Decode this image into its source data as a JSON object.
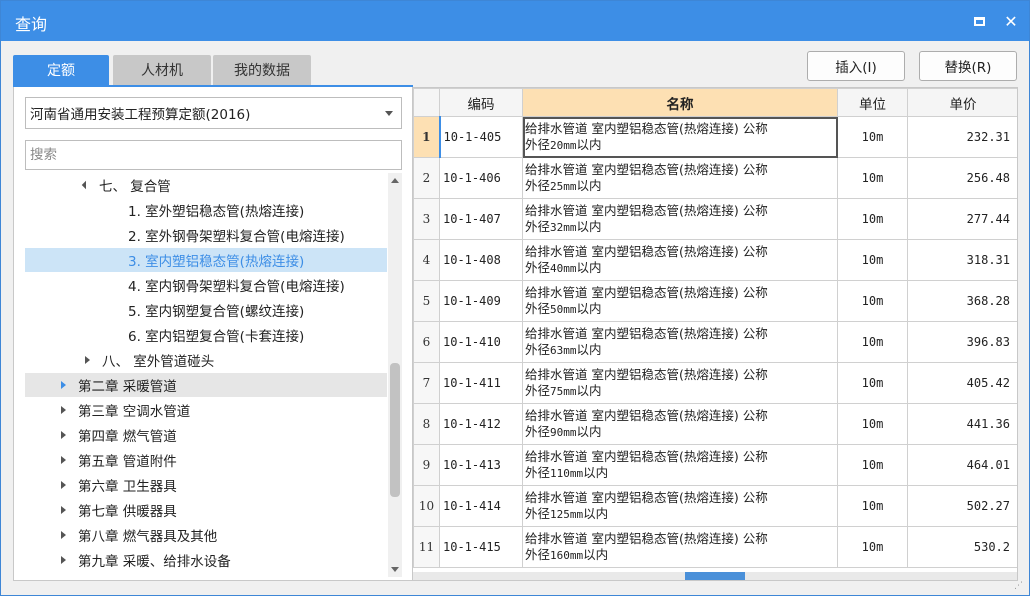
{
  "window": {
    "title": "查询"
  },
  "tabs": [
    "定额",
    "人材机",
    "我的数据"
  ],
  "toolbar": {
    "insert_label": "插入(I)",
    "replace_label": "替换(R)"
  },
  "dropdown": {
    "selected": "河南省通用安装工程预算定额(2016)"
  },
  "search": {
    "placeholder": "搜索"
  },
  "tree": {
    "group_7": "七、 复合管",
    "items_7": [
      "1. 室外塑铝稳态管(热熔连接)",
      "2. 室外钢骨架塑料复合管(电熔连接)",
      "3. 室内塑铝稳态管(热熔连接)",
      "4. 室内钢骨架塑料复合管(电熔连接)",
      "5. 室内钢塑复合管(螺纹连接)",
      "6. 室内铝塑复合管(卡套连接)"
    ],
    "group_8": "八、 室外管道碰头",
    "chapters": [
      "第二章 采暖管道",
      "第三章 空调水管道",
      "第四章 燃气管道",
      "第五章 管道附件",
      "第六章 卫生器具",
      "第七章 供暖器具",
      "第八章 燃气器具及其他",
      "第九章 采暖、给排水设备"
    ]
  },
  "table": {
    "headers": [
      "编码",
      "名称",
      "单位",
      "单价"
    ],
    "rows": [
      {
        "n": "1",
        "code": "10-1-405",
        "name1": "给排水管道 室内塑铝稳态管(热熔连接) 公称",
        "name2a": "外径",
        "name2b": "20mm",
        "name2c": "以内",
        "unit": "10m",
        "price": "232.31"
      },
      {
        "n": "2",
        "code": "10-1-406",
        "name1": "给排水管道 室内塑铝稳态管(热熔连接) 公称",
        "name2a": "外径",
        "name2b": "25mm",
        "name2c": "以内",
        "unit": "10m",
        "price": "256.48"
      },
      {
        "n": "3",
        "code": "10-1-407",
        "name1": "给排水管道 室内塑铝稳态管(热熔连接) 公称",
        "name2a": "外径",
        "name2b": "32mm",
        "name2c": "以内",
        "unit": "10m",
        "price": "277.44"
      },
      {
        "n": "4",
        "code": "10-1-408",
        "name1": "给排水管道 室内塑铝稳态管(热熔连接) 公称",
        "name2a": "外径",
        "name2b": "40mm",
        "name2c": "以内",
        "unit": "10m",
        "price": "318.31"
      },
      {
        "n": "5",
        "code": "10-1-409",
        "name1": "给排水管道 室内塑铝稳态管(热熔连接) 公称",
        "name2a": "外径",
        "name2b": "50mm",
        "name2c": "以内",
        "unit": "10m",
        "price": "368.28"
      },
      {
        "n": "6",
        "code": "10-1-410",
        "name1": "给排水管道 室内塑铝稳态管(热熔连接) 公称",
        "name2a": "外径",
        "name2b": "63mm",
        "name2c": "以内",
        "unit": "10m",
        "price": "396.83"
      },
      {
        "n": "7",
        "code": "10-1-411",
        "name1": "给排水管道 室内塑铝稳态管(热熔连接) 公称",
        "name2a": "外径",
        "name2b": "75mm",
        "name2c": "以内",
        "unit": "10m",
        "price": "405.42"
      },
      {
        "n": "8",
        "code": "10-1-412",
        "name1": "给排水管道 室内塑铝稳态管(热熔连接) 公称",
        "name2a": "外径",
        "name2b": "90mm",
        "name2c": "以内",
        "unit": "10m",
        "price": "441.36"
      },
      {
        "n": "9",
        "code": "10-1-413",
        "name1": "给排水管道 室内塑铝稳态管(热熔连接) 公称",
        "name2a": "外径",
        "name2b": "110mm",
        "name2c": "以内",
        "unit": "10m",
        "price": "464.01"
      },
      {
        "n": "10",
        "code": "10-1-414",
        "name1": "给排水管道 室内塑铝稳态管(热熔连接) 公称",
        "name2a": "外径",
        "name2b": "125mm",
        "name2c": "以内",
        "unit": "10m",
        "price": "502.27"
      },
      {
        "n": "11",
        "code": "10-1-415",
        "name1": "给排水管道 室内塑铝稳态管(热熔连接) 公称",
        "name2a": "外径",
        "name2b": "160mm",
        "name2c": "以内",
        "unit": "10m",
        "price": "530.2"
      }
    ]
  },
  "colors": {
    "accent": "#3d8ee6",
    "header_highlight": "#fde0b3",
    "selection": "#cce4f7"
  }
}
